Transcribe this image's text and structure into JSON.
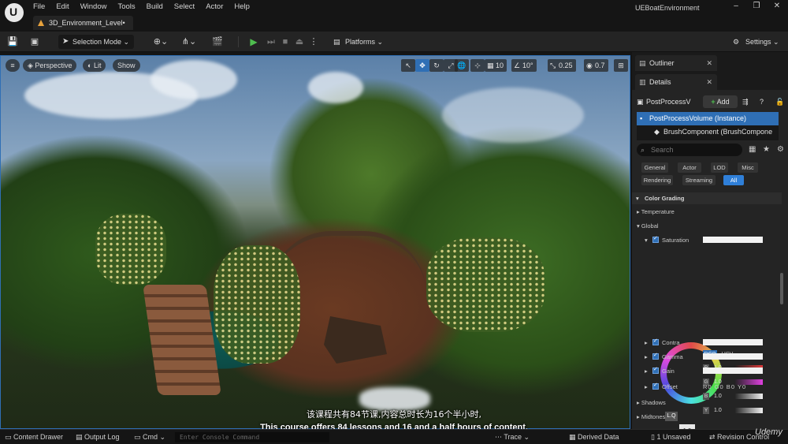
{
  "menu": [
    "File",
    "Edit",
    "Window",
    "Tools",
    "Build",
    "Select",
    "Actor",
    "Help"
  ],
  "doc_tab": "3D_Environment_Level•",
  "project_name": "UEBoatEnvironment",
  "window_controls": [
    "–",
    "❐",
    "✕"
  ],
  "toolbar": {
    "mode": "Selection Mode",
    "platforms": "Platforms",
    "settings": "Settings"
  },
  "viewport": {
    "perspective": "Perspective",
    "lit": "Lit",
    "show": "Show",
    "grid_snap": "10",
    "rot_snap": "10°",
    "scale_snap": "0.25",
    "camera_speed": "0.7"
  },
  "outliner": {
    "tab": "Outliner"
  },
  "details": {
    "tab": "Details",
    "object": "PostProcessV",
    "add": "Add",
    "items": [
      "PostProcessVolume (Instance)",
      "BrushComponent (BrushCompone"
    ],
    "search_placeholder": "Search",
    "filters": [
      "General",
      "Actor",
      "LOD",
      "Misc",
      "Rendering",
      "Streaming",
      "All"
    ],
    "categories": [
      "Color Grading",
      "Temperature",
      "Global",
      "Shadows",
      "Midtones"
    ],
    "props": {
      "saturation": "Saturation",
      "contrast": "Contra",
      "gamma": "Gamma",
      "gain": "Gain",
      "offset": "Offset"
    },
    "color_mode": [
      "RGB",
      "HSV"
    ],
    "channels": [
      {
        "tag": "R",
        "value": "1.0"
      },
      {
        "tag": "G",
        "value": "1.0"
      },
      {
        "tag": "B",
        "value": "1.0"
      },
      {
        "tag": "Y",
        "value": "1.0"
      }
    ],
    "offset_values": [
      "R",
      "0",
      "G",
      "0",
      "B",
      "0",
      "Y",
      "0"
    ],
    "tooltip_value": "1.0",
    "lq_label": "L.Q"
  },
  "subtitles": {
    "cn": "该课程共有84节课,内容总时长为16个半小时,",
    "en": "This course offers 84 lessons and 16 and a half hours of content,"
  },
  "statusbar": {
    "content_drawer": "Content Drawer",
    "output_log": "Output Log",
    "cmd": "Cmd",
    "console_placeholder": "Enter Console Command",
    "trace": "Trace",
    "derived_data": "Derived Data",
    "unsaved": "1 Unsaved",
    "revision": "Revision Control"
  },
  "watermark": "Udemy"
}
